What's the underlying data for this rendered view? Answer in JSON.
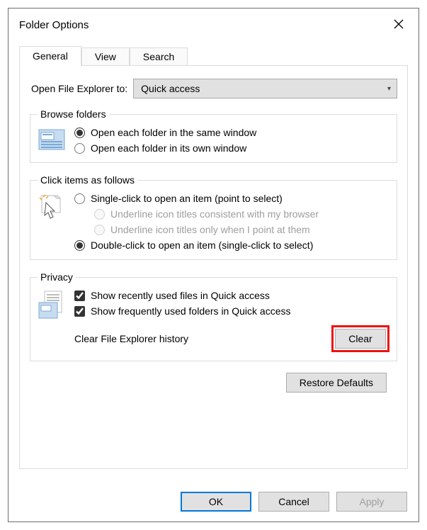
{
  "window": {
    "title": "Folder Options"
  },
  "tabs": {
    "general": "General",
    "view": "View",
    "search": "Search"
  },
  "open_to": {
    "label": "Open File Explorer to:",
    "value": "Quick access"
  },
  "browse": {
    "legend": "Browse folders",
    "same": "Open each folder in the same window",
    "own": "Open each folder in its own window"
  },
  "click": {
    "legend": "Click items as follows",
    "single": "Single-click to open an item (point to select)",
    "under_browser": "Underline icon titles consistent with my browser",
    "under_point": "Underline icon titles only when I point at them",
    "double": "Double-click to open an item (single-click to select)"
  },
  "privacy": {
    "legend": "Privacy",
    "recent": "Show recently used files in Quick access",
    "frequent": "Show frequently used folders in Quick access",
    "clear_label": "Clear File Explorer history",
    "clear_btn": "Clear"
  },
  "restore": "Restore Defaults",
  "buttons": {
    "ok": "OK",
    "cancel": "Cancel",
    "apply": "Apply"
  }
}
